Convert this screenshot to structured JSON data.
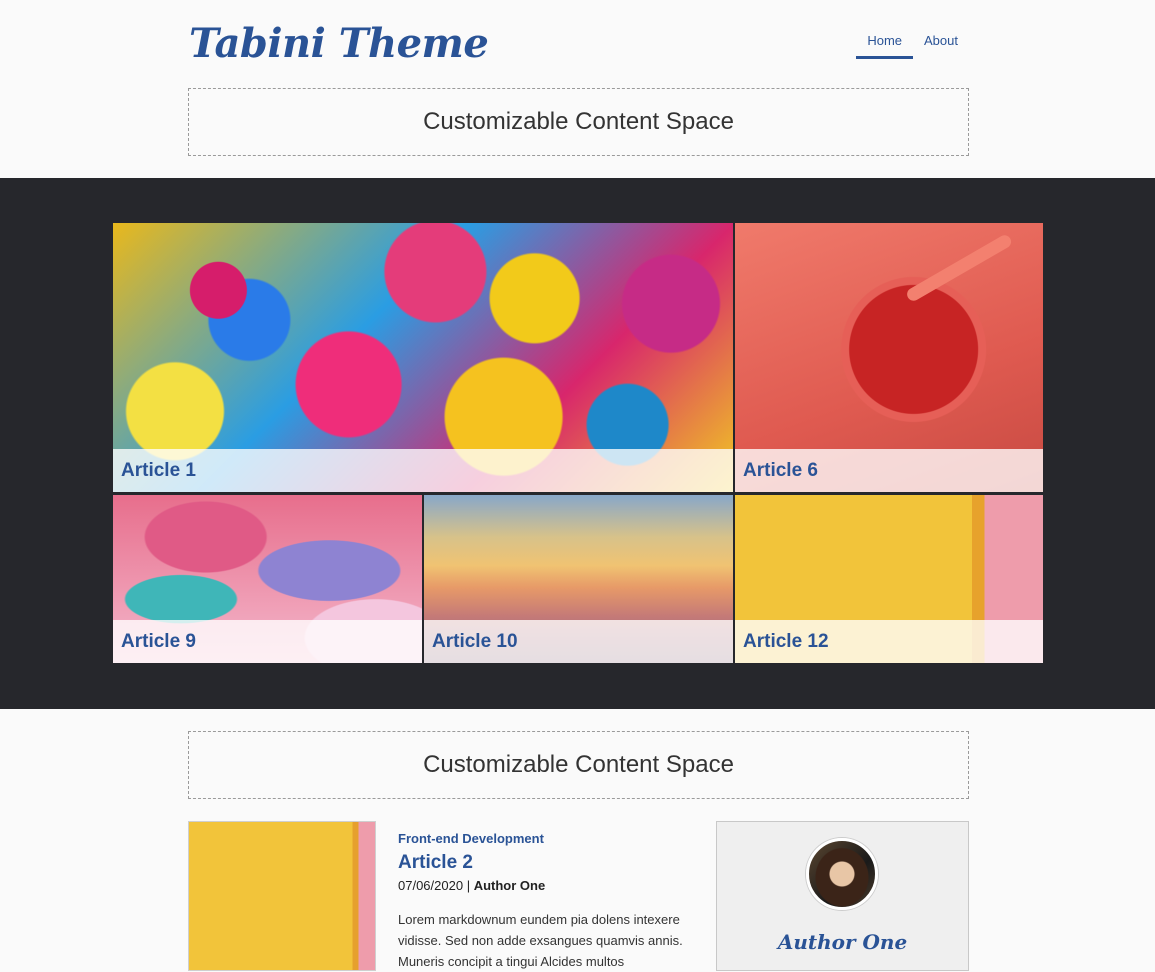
{
  "site": {
    "logo": "Tabini Theme"
  },
  "nav": {
    "items": [
      {
        "label": "Home",
        "active": true
      },
      {
        "label": "About",
        "active": false
      }
    ]
  },
  "content_space": {
    "top": "Customizable Content Space",
    "middle": "Customizable Content Space"
  },
  "featured": [
    {
      "title": "Article 1",
      "image": "rainbow-roses"
    },
    {
      "title": "Article 6",
      "image": "red-smoothie"
    },
    {
      "title": "Article 9",
      "image": "sprinkle-donuts"
    },
    {
      "title": "Article 10",
      "image": "sunset-mountains"
    },
    {
      "title": "Article 12",
      "image": "yellow-wall"
    }
  ],
  "article": {
    "category": "Front-end Development",
    "title": "Article 2",
    "date": "07/06/2020",
    "separator": " | ",
    "author": "Author One",
    "excerpt": "Lorem markdownum eundem pia dolens intexere vidisse. Sed non adde exsangues quamvis annis. Muneris concipit a tingui Alcides multos"
  },
  "author_card": {
    "name": "Author One"
  },
  "colors": {
    "accent": "#2a5396",
    "band": "#26272c",
    "page": "#fafafa"
  }
}
